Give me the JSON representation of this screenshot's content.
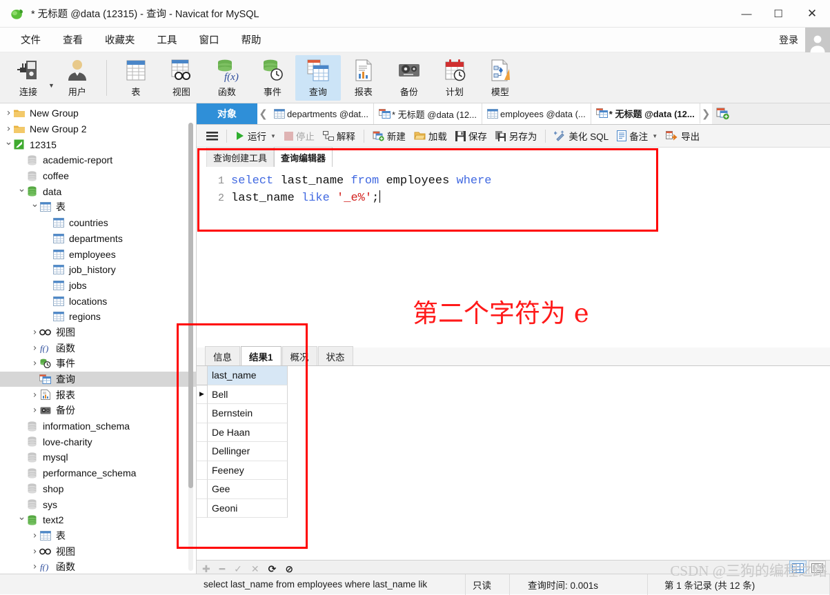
{
  "window": {
    "title": "* 无标题 @data (12315) - 查询 - Navicat for MySQL",
    "minimize": "—",
    "maximize": "☐",
    "close": "✕"
  },
  "menubar": {
    "items": [
      {
        "label": "文件"
      },
      {
        "label": "查看"
      },
      {
        "label": "收藏夹"
      },
      {
        "label": "工具"
      },
      {
        "label": "窗口"
      },
      {
        "label": "帮助"
      }
    ],
    "login_label": "登录"
  },
  "toolbar": {
    "items": [
      {
        "label": "连接",
        "icon": "connection-icon"
      },
      {
        "label": "用户",
        "icon": "user-icon"
      },
      {
        "label": "表",
        "icon": "table-icon"
      },
      {
        "label": "视图",
        "icon": "view-icon"
      },
      {
        "label": "函数",
        "icon": "function-icon"
      },
      {
        "label": "事件",
        "icon": "event-icon"
      },
      {
        "label": "查询",
        "icon": "query-icon"
      },
      {
        "label": "报表",
        "icon": "report-icon"
      },
      {
        "label": "备份",
        "icon": "backup-icon"
      },
      {
        "label": "计划",
        "icon": "schedule-icon"
      },
      {
        "label": "模型",
        "icon": "model-icon"
      }
    ],
    "active": "查询"
  },
  "sidebar": {
    "nodes": [
      {
        "label": "New Group",
        "indent": 0,
        "arrow": "closed",
        "icon": "folder-icon",
        "selected": false
      },
      {
        "label": "New Group 2",
        "indent": 0,
        "arrow": "closed",
        "icon": "folder-icon",
        "selected": false
      },
      {
        "label": "12315",
        "indent": 0,
        "arrow": "open",
        "icon": "connection-green-icon",
        "selected": false
      },
      {
        "label": "academic-report",
        "indent": 1,
        "arrow": "none",
        "icon": "db-gray-icon",
        "selected": false
      },
      {
        "label": "coffee",
        "indent": 1,
        "arrow": "none",
        "icon": "db-gray-icon",
        "selected": false
      },
      {
        "label": "data",
        "indent": 1,
        "arrow": "open",
        "icon": "db-green-icon",
        "selected": false
      },
      {
        "label": "表",
        "indent": 2,
        "arrow": "open",
        "icon": "table-icon",
        "selected": false
      },
      {
        "label": "countries",
        "indent": 3,
        "arrow": "none",
        "icon": "table-icon",
        "selected": false
      },
      {
        "label": "departments",
        "indent": 3,
        "arrow": "none",
        "icon": "table-icon",
        "selected": false
      },
      {
        "label": "employees",
        "indent": 3,
        "arrow": "none",
        "icon": "table-icon",
        "selected": false
      },
      {
        "label": "job_history",
        "indent": 3,
        "arrow": "none",
        "icon": "table-icon",
        "selected": false
      },
      {
        "label": "jobs",
        "indent": 3,
        "arrow": "none",
        "icon": "table-icon",
        "selected": false
      },
      {
        "label": "locations",
        "indent": 3,
        "arrow": "none",
        "icon": "table-icon",
        "selected": false
      },
      {
        "label": "regions",
        "indent": 3,
        "arrow": "none",
        "icon": "table-icon",
        "selected": false
      },
      {
        "label": "视图",
        "indent": 2,
        "arrow": "closed",
        "icon": "view-icon",
        "selected": false
      },
      {
        "label": "函数",
        "indent": 2,
        "arrow": "closed",
        "icon": "function-icon",
        "selected": false
      },
      {
        "label": "事件",
        "indent": 2,
        "arrow": "closed",
        "icon": "event-icon",
        "selected": false
      },
      {
        "label": "查询",
        "indent": 2,
        "arrow": "none",
        "icon": "query-icon",
        "selected": true
      },
      {
        "label": "报表",
        "indent": 2,
        "arrow": "closed",
        "icon": "report-icon",
        "selected": false
      },
      {
        "label": "备份",
        "indent": 2,
        "arrow": "closed",
        "icon": "backup-icon",
        "selected": false
      },
      {
        "label": "information_schema",
        "indent": 1,
        "arrow": "none",
        "icon": "db-gray-icon",
        "selected": false
      },
      {
        "label": "love-charity",
        "indent": 1,
        "arrow": "none",
        "icon": "db-gray-icon",
        "selected": false
      },
      {
        "label": "mysql",
        "indent": 1,
        "arrow": "none",
        "icon": "db-gray-icon",
        "selected": false
      },
      {
        "label": "performance_schema",
        "indent": 1,
        "arrow": "none",
        "icon": "db-gray-icon",
        "selected": false
      },
      {
        "label": "shop",
        "indent": 1,
        "arrow": "none",
        "icon": "db-gray-icon",
        "selected": false
      },
      {
        "label": "sys",
        "indent": 1,
        "arrow": "none",
        "icon": "db-gray-icon",
        "selected": false
      },
      {
        "label": "text2",
        "indent": 1,
        "arrow": "open",
        "icon": "db-green-icon",
        "selected": false
      },
      {
        "label": "表",
        "indent": 2,
        "arrow": "closed",
        "icon": "table-icon",
        "selected": false
      },
      {
        "label": "视图",
        "indent": 2,
        "arrow": "closed",
        "icon": "view-icon",
        "selected": false
      },
      {
        "label": "函数",
        "indent": 2,
        "arrow": "closed",
        "icon": "function-icon",
        "selected": false
      }
    ]
  },
  "tabstrip": {
    "object_tab": "对象",
    "prev_arrow": "❮",
    "next_arrow": "❯",
    "tabs": [
      {
        "label": "departments @dat...",
        "icon": "table-icon",
        "active": false
      },
      {
        "label": "* 无标题 @data (12...",
        "icon": "query-icon",
        "active": false
      },
      {
        "label": "employees @data (...",
        "icon": "table-icon",
        "active": false
      },
      {
        "label": "* 无标题 @data (12...",
        "icon": "query-icon",
        "active": true
      }
    ],
    "new_tab_icon": "new-tab-icon"
  },
  "query_toolbar": {
    "menu_icon": "hamburger-icon",
    "buttons": [
      {
        "label": "运行",
        "icon": "play-icon",
        "caret": true,
        "disabled": false
      },
      {
        "label": "停止",
        "icon": "stop-icon",
        "caret": false,
        "disabled": true
      },
      {
        "label": "解释",
        "icon": "explain-icon",
        "caret": false,
        "disabled": false
      },
      {
        "label": "新建",
        "icon": "new-icon",
        "caret": false,
        "disabled": false
      },
      {
        "label": "加载",
        "icon": "load-icon",
        "caret": false,
        "disabled": false
      },
      {
        "label": "保存",
        "icon": "save-icon",
        "caret": false,
        "disabled": false
      },
      {
        "label": "另存为",
        "icon": "save-as-icon",
        "caret": false,
        "disabled": false
      },
      {
        "label": "美化 SQL",
        "icon": "beautify-icon",
        "caret": false,
        "disabled": false
      },
      {
        "label": "备注",
        "icon": "comment-icon",
        "caret": true,
        "disabled": false
      },
      {
        "label": "导出",
        "icon": "export-icon",
        "caret": false,
        "disabled": false
      }
    ]
  },
  "editor": {
    "tabs": [
      {
        "label": "查询创建工具",
        "active": false
      },
      {
        "label": "查询编辑器",
        "active": true
      }
    ],
    "lines": [
      {
        "num": "1",
        "tokens": [
          {
            "t": "select ",
            "c": "kw"
          },
          {
            "t": "last_name ",
            "c": "id"
          },
          {
            "t": "from ",
            "c": "kw"
          },
          {
            "t": "employees ",
            "c": "id"
          },
          {
            "t": "where",
            "c": "kw"
          }
        ]
      },
      {
        "num": "2",
        "tokens": [
          {
            "t": "last_name ",
            "c": "id"
          },
          {
            "t": "like ",
            "c": "kw"
          },
          {
            "t": "'_e%'",
            "c": "str"
          },
          {
            "t": ";",
            "c": "id"
          }
        ]
      }
    ],
    "full_sql": "select last_name from employees where last_name like '_e%';"
  },
  "annotation": {
    "text": "第二个字符为 e",
    "color": "#ff1a1a"
  },
  "results": {
    "tabs": [
      {
        "label": "信息",
        "active": false
      },
      {
        "label": "结果1",
        "active": true
      },
      {
        "label": "概况",
        "active": false
      },
      {
        "label": "状态",
        "active": false
      }
    ],
    "columns": [
      "last_name"
    ],
    "rows": [
      {
        "last_name": "Bell",
        "current": true
      },
      {
        "last_name": "Bernstein",
        "current": false
      },
      {
        "last_name": "De Haan",
        "current": false
      },
      {
        "last_name": "Dellinger",
        "current": false
      },
      {
        "last_name": "Feeney",
        "current": false
      },
      {
        "last_name": "Gee",
        "current": false
      },
      {
        "last_name": "Geoni",
        "current": false
      }
    ],
    "grid_buttons": [
      {
        "icon": "plus-icon",
        "name": "add-record-button",
        "enabled": false
      },
      {
        "icon": "minus-icon",
        "name": "delete-record-button",
        "enabled": false
      },
      {
        "icon": "check-icon",
        "name": "apply-change-button",
        "enabled": false
      },
      {
        "icon": "cross-icon",
        "name": "cancel-change-button",
        "enabled": false
      },
      {
        "icon": "refresh-icon",
        "name": "refresh-button",
        "enabled": true
      },
      {
        "icon": "stop-circle-icon",
        "name": "stop-loading-button",
        "enabled": true
      }
    ],
    "view_toggle": [
      {
        "icon": "grid-view-icon",
        "active": true
      },
      {
        "icon": "form-view-icon",
        "active": false
      }
    ]
  },
  "statusbar": {
    "sql": "select last_name from employees where last_name lik",
    "readonly": "只读",
    "query_time": "查询时间: 0.001s",
    "record_info": "第 1 条记录 (共 12 条)",
    "watermark": "CSDN @三狗的编程之路"
  },
  "colors": {
    "accent_blue": "#2f8fd8",
    "annotation_red": "#ff0000",
    "toolbar_bg": "#f1f1f1",
    "active_tool_bg": "#cce4f7",
    "header_cell": "#d7e7f5",
    "selection_gray": "#d6d6d6"
  }
}
